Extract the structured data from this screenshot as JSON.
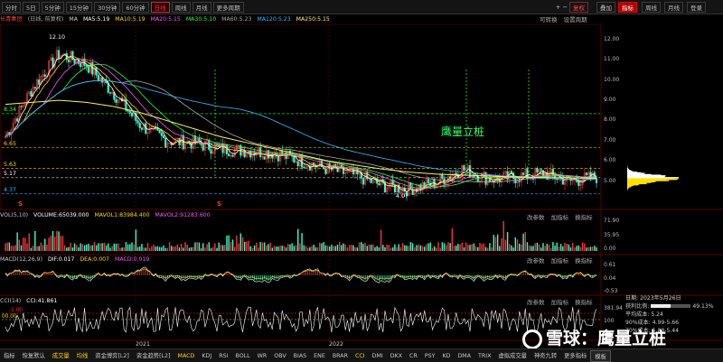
{
  "period_bar": {
    "periods": [
      "分时",
      "5日",
      "5分钟",
      "15分钟",
      "30分钟",
      "60分钟",
      "日线",
      "周线",
      "月线",
      "更多周期"
    ],
    "active_index": 6,
    "plus": "+",
    "minus": "−",
    "reinstate": "复权",
    "overlay": "叠加",
    "indicators": "指标",
    "weekly": "周线",
    "monthly": "月线",
    "login": "登录"
  },
  "info_line": {
    "stock_name": "长青集团",
    "stock_sub": "(日线, 前复权)",
    "ma_label": "MA",
    "ma5": "MA5:5.19",
    "ma10": "MA10:5.19",
    "ma20": "MA20:5.15",
    "ma30": "MA30:5.10",
    "ma60": "MA60:5.23",
    "ma120": "MA120:5.23",
    "ma250": "MA250:5.15",
    "visible_ranges": "可转换",
    "settings": "设置周期"
  },
  "price_chart": {
    "y_ticks": [
      "12.00",
      "11.00",
      "10.00",
      "9.00",
      "8.00",
      "7.00",
      "6.00",
      "5.00"
    ],
    "levels": [
      {
        "label": "8.34",
        "value": 8.34,
        "color": "#33ff33"
      },
      {
        "label": "6.65",
        "value": 6.65,
        "color": "#ffd700"
      },
      {
        "label": "5.63",
        "value": 5.63,
        "color": "#ffd700"
      },
      {
        "label": "5.17",
        "value": 5.17,
        "color": "#ffffff"
      },
      {
        "label": "4.37",
        "value": 4.37,
        "color": "#33bbff"
      }
    ],
    "high_label": "12.10",
    "low_label": "4.07",
    "annotation": "鹰量立桩",
    "marker": "S"
  },
  "vol_panel": {
    "name": "VOL(5,10)",
    "volume": "VOLUME:65039.000",
    "mavol1": "MAVOL1:83984.400",
    "mavol2": "MAVOL2:91283.600",
    "y_ticks": [
      "71.90",
      "35.95",
      "0.00"
    ],
    "tools": [
      "改参数",
      "加指标",
      "换指标"
    ]
  },
  "macd_panel": {
    "name": "MACD(12,26,9)",
    "dif": "DIF:0.017",
    "dea": "DEA:0.007",
    "macd": "MACD:0.019",
    "y_ticks": [
      "0.61",
      "0.04",
      "-0.53"
    ],
    "tools": [
      "改参数",
      "加指标",
      "换指标"
    ]
  },
  "cci_panel": {
    "name": "CCI(14)",
    "cci": "CCI:41.861",
    "y_ticks": [
      "381.94",
      "100"
    ],
    "left_ticks": [
      "-1.00",
      "00.00"
    ],
    "tools": [
      "改参数",
      "加指标",
      "换指标"
    ]
  },
  "x_axis": {
    "labels": [
      "2021",
      "2022"
    ]
  },
  "side_panel": {
    "date": "日期: 2023年5月26日",
    "profit_ratio_label": "获利比例:",
    "profit_ratio": "49.13%",
    "avg_cost": "平均成本: 5.24",
    "concentration": "90%成本: 4.99-5.66",
    "concentration2": "70%成本: 5.08-5.44"
  },
  "bottom_tabs": [
    "指标",
    "恢复默认",
    "成交量",
    "均线",
    "资金博弈[L2]",
    "资金趋势[L2]",
    "MACD",
    "KDJ",
    "RSI",
    "BOLL",
    "WR",
    "OBV",
    "BIAS",
    "ENE",
    "BRAR",
    "CCI",
    "DMI",
    "DKX",
    "CR",
    "PSY",
    "KD",
    "DMA",
    "TRIX",
    "虚拟成交量",
    "神奇九转",
    "更多指标",
    "模板"
  ],
  "watermark": "雪球：鹰量立桩",
  "colors": {
    "up": "#ff3333",
    "down": "#33ffcc",
    "ma5": "#ffffff",
    "ma10": "#ffd700",
    "ma20": "#ff55ff",
    "ma30": "#33ff33",
    "ma60": "#aaaaaa",
    "ma120": "#33bbff",
    "ma250": "#ffee66"
  },
  "chart_data": {
    "type": "line",
    "title": "长青集团",
    "xlabel": "",
    "ylabel": "",
    "ylim": [
      4.0,
      12.4
    ],
    "x_labels": [
      "2021",
      "2022"
    ],
    "series": [
      {
        "name": "MA5",
        "values": [
          7.2,
          9.6,
          11.3,
          10.8,
          9.4,
          7.8,
          7.0,
          6.9,
          6.6,
          6.5,
          6.4,
          6.0,
          5.6,
          5.3,
          4.8,
          4.6,
          4.9,
          5.6,
          5.1,
          5.2,
          5.4,
          5.0,
          5.2
        ]
      },
      {
        "name": "MA250",
        "values": [
          8.8,
          8.9,
          9.0,
          8.9,
          8.7,
          8.4,
          8.0,
          7.6,
          7.2,
          6.9,
          6.6,
          6.3,
          6.0,
          5.8,
          5.6,
          5.45,
          5.35,
          5.3,
          5.25,
          5.2,
          5.18,
          5.16,
          5.15
        ]
      }
    ]
  }
}
